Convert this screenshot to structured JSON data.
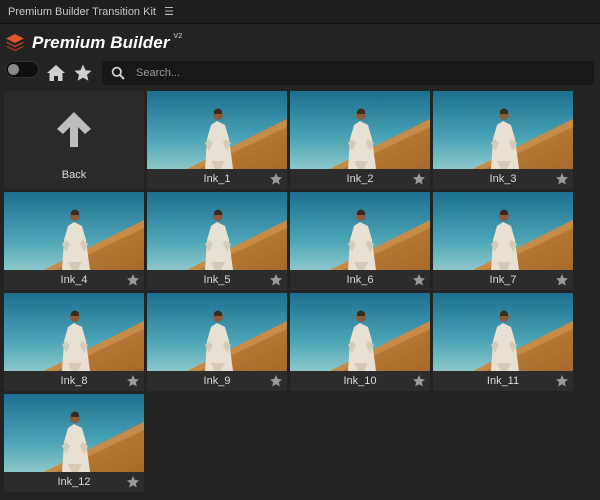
{
  "window": {
    "title": "Premium Builder Transition Kit",
    "menu_icon": "hamburger-icon"
  },
  "brand": {
    "name": "Premium Builder",
    "version": "V2",
    "accent": "#e2542a"
  },
  "toolbar": {
    "search_placeholder": "Search..."
  },
  "back": {
    "label": "Back"
  },
  "items": [
    {
      "label": "Ink_1"
    },
    {
      "label": "Ink_2"
    },
    {
      "label": "Ink_3"
    },
    {
      "label": "Ink_4"
    },
    {
      "label": "Ink_5"
    },
    {
      "label": "Ink_6"
    },
    {
      "label": "Ink_7"
    },
    {
      "label": "Ink_8"
    },
    {
      "label": "Ink_9"
    },
    {
      "label": "Ink_10"
    },
    {
      "label": "Ink_11"
    },
    {
      "label": "Ink_12"
    }
  ]
}
